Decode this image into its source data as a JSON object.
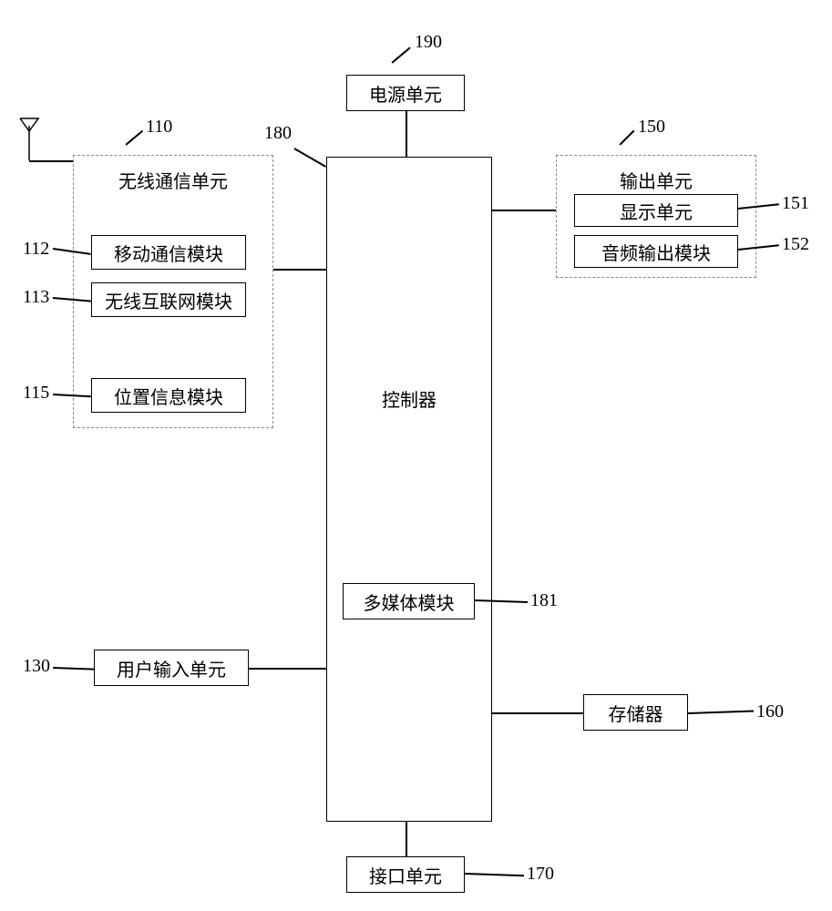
{
  "refs": {
    "r190": "190",
    "r110": "110",
    "r112": "112",
    "r113": "113",
    "r115": "115",
    "r180": "180",
    "r150": "150",
    "r151": "151",
    "r152": "152",
    "r181": "181",
    "r130": "130",
    "r160": "160",
    "r170": "170"
  },
  "labels": {
    "power_unit": "电源单元",
    "wireless_unit": "无线通信单元",
    "mobile_comm_module": "移动通信模块",
    "wireless_internet_module": "无线互联网模块",
    "location_info_module": "位置信息模块",
    "controller": "控制器",
    "output_unit": "输出单元",
    "display_unit": "显示单元",
    "audio_output_module": "音频输出模块",
    "multimedia_module": "多媒体模块",
    "user_input_unit": "用户输入单元",
    "memory": "存储器",
    "interface_unit": "接口单元"
  }
}
